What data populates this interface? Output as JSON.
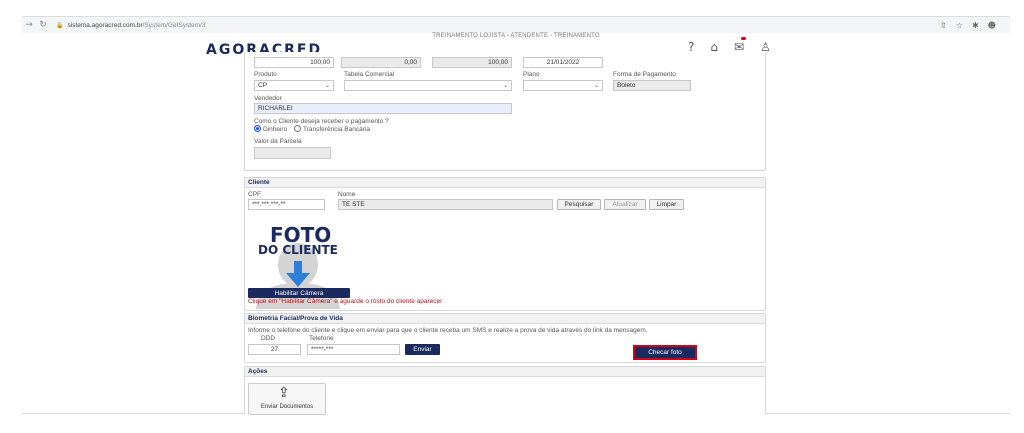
{
  "browser": {
    "url_host": "sistema.agoracred.com.br",
    "url_path": "/System/GetSystem/3"
  },
  "header": {
    "title": "TREINAMENTO LOJISTA - ATENDENTE - TREINAMENTO",
    "logo": "AGORACRED"
  },
  "proposal": {
    "values": [
      "100,00",
      "0,00",
      "100,00"
    ],
    "date": "21/01/2022",
    "produto_label": "Produto",
    "produto_value": "CP",
    "tabela_label": "Tabela Comercial",
    "plano_label": "Plano",
    "forma_label": "Forma de Pagamento",
    "forma_value": "Boleto",
    "vendedor_label": "Vendedor",
    "vendedor_value": "RICHARLEI",
    "question": "Como o Cliente deseja receber o pagamento ?",
    "option_dinheiro": "Dinheiro",
    "option_transferencia": "Transferência Bancária",
    "parcela_label": "Valor da Parcela"
  },
  "cliente": {
    "title": "Cliente",
    "cpf_label": "CPF",
    "cpf_value": "***.***.***-**",
    "nome_label": "Nome",
    "nome_value": "TE STE",
    "pesquisar": "Pesquisar",
    "atualizar": "Atualizar",
    "limpar": "Limpar",
    "photo_title": "FOTO",
    "photo_sub": "DO CLIENTE",
    "camera_button": "Habilitar Câmera",
    "camera_note": "Clique em \"Habilitar Câmera\" e aguarde o rosto do cliente aparecer"
  },
  "biometria": {
    "title": "Biometria Facial/Prova de Vida",
    "instructions": "Informe o telefone do cliente e clique em enviar para que o cliente receba um SMS e realize a prova de vida através do link da mensagem.",
    "ddd_label": "DDD",
    "ddd_value": "27",
    "telefone_label": "Telefone",
    "telefone_value": "*****-***",
    "enviar": "Enviar",
    "checar": "Checar foto"
  },
  "acoes": {
    "title": "Ações",
    "enviar_documentos": "Enviar Documentos"
  },
  "colors": {
    "navy": "#1b2a5e",
    "highlight": "#d0021b",
    "note_red": "#c0101a"
  }
}
